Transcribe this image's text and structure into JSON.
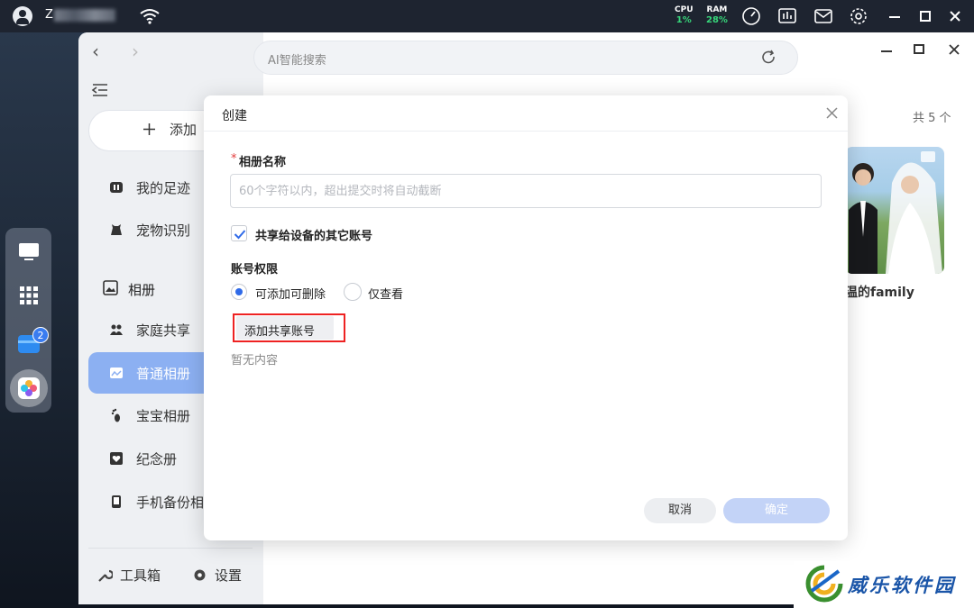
{
  "system_bar": {
    "user_name": "Z",
    "cpu": {
      "label": "CPU",
      "value": "1%"
    },
    "ram": {
      "label": "RAM",
      "value": "28%"
    }
  },
  "dock": {
    "badge_count": "2"
  },
  "search": {
    "placeholder": "AI智能搜索"
  },
  "sidebar": {
    "add_label": "添加",
    "items": [
      {
        "label": "我的足迹",
        "icon": "footprint-icon"
      },
      {
        "label": "宠物识别",
        "icon": "pet-icon"
      }
    ],
    "section": "相册",
    "album_items": [
      {
        "label": "家庭共享",
        "icon": "family-icon"
      },
      {
        "label": "普通相册",
        "icon": "album-icon",
        "active": true
      },
      {
        "label": "宝宝相册",
        "icon": "baby-foot-icon"
      },
      {
        "label": "纪念册",
        "icon": "heart-book-icon"
      },
      {
        "label": "手机备份相",
        "icon": "phone-backup-icon"
      }
    ],
    "toolbox_label": "工具箱",
    "settings_label": "设置"
  },
  "main": {
    "count_text": "共 5 个",
    "album_title": "温的family"
  },
  "dialog": {
    "title": "创建",
    "required_mark": "*",
    "name_label": "相册名称",
    "name_placeholder": "60个字符以内，超出提交时将自动截断",
    "share_checkbox_label": "共享给设备的其它账号",
    "share_checked": true,
    "permission_label": "账号权限",
    "permissions": [
      {
        "label": "可添加可删除",
        "selected": true
      },
      {
        "label": "仅查看",
        "selected": false
      }
    ],
    "add_share_button": "添加共享账号",
    "empty_text": "暂无内容",
    "cancel_button": "取消",
    "ok_button": "确定"
  },
  "watermark": {
    "text": "威乐软件园"
  },
  "colors": {
    "accent": "#2f6ae8",
    "active_nav": "#8cb0f2",
    "highlight_border": "#e22222"
  }
}
